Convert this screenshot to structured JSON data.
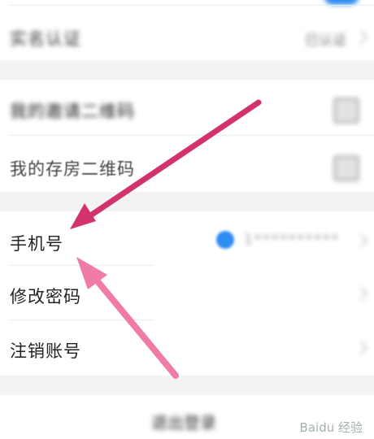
{
  "settings": {
    "top_row_blurred": "实名认证",
    "top_row_value_blurred": "已认证",
    "group2": [
      {
        "label": "我的邀请二维码"
      },
      {
        "label": "我的存房二维码"
      }
    ],
    "group3": [
      {
        "label": "手机号",
        "value_blurred": "1**********"
      },
      {
        "label": "修改密码"
      },
      {
        "label": "注销账号"
      }
    ],
    "logout_label_blurred": "退出登录"
  },
  "annotations": {
    "arrow_dark_color": "#d2336f",
    "arrow_light_color": "#f07ba6"
  },
  "watermark": "Baidu 经验"
}
